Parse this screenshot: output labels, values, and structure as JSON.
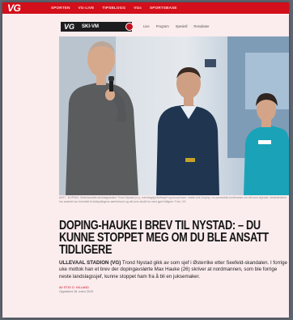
{
  "topbar": {
    "logo": "VG",
    "nav": [
      "SPORTEN",
      "VG-LIVE",
      "TIPSBLOGG",
      "VGs",
      "SPORTSBASE"
    ]
  },
  "section": {
    "badge_logo": "VG",
    "badge_label": "SKI-VM",
    "nav": [
      "Live",
      "Program",
      "Spesiell",
      "Resultater"
    ]
  },
  "caption": "ANTI · DOPING: Skiforbundets landslagsledere Trond Nystad (t.v.), med daglig idrettssjef og kronprinsen, møtte Anti-Doping i en presseinfo-konferanse om det som skjedde. Idrettslederne har snakket om forholdet til skiskyttingens særforbund og det som skulle ha vært gjort tidligere. Foto: VG",
  "headline": "Doping-Hauke i brev til Nystad: – Du kunne stoppet meg om du ble ansatt tidligere",
  "lead": {
    "place": "ULLEVAAL STADION (VG)",
    "text": " Trond Nystad gikk av som sjef i Østerrike etter Seefeld-skandalen. I forrige uke mottok han et brev der dopingavslørte Max Hauke (26) skriver at nordmannen, som ble forrige neste landslagssjef, kunne stoppet ham fra å bli en juksemaker."
  },
  "byline": {
    "author": "AV STIG O. HILLAND",
    "date": "Oppdatert 18. mars 2019"
  }
}
